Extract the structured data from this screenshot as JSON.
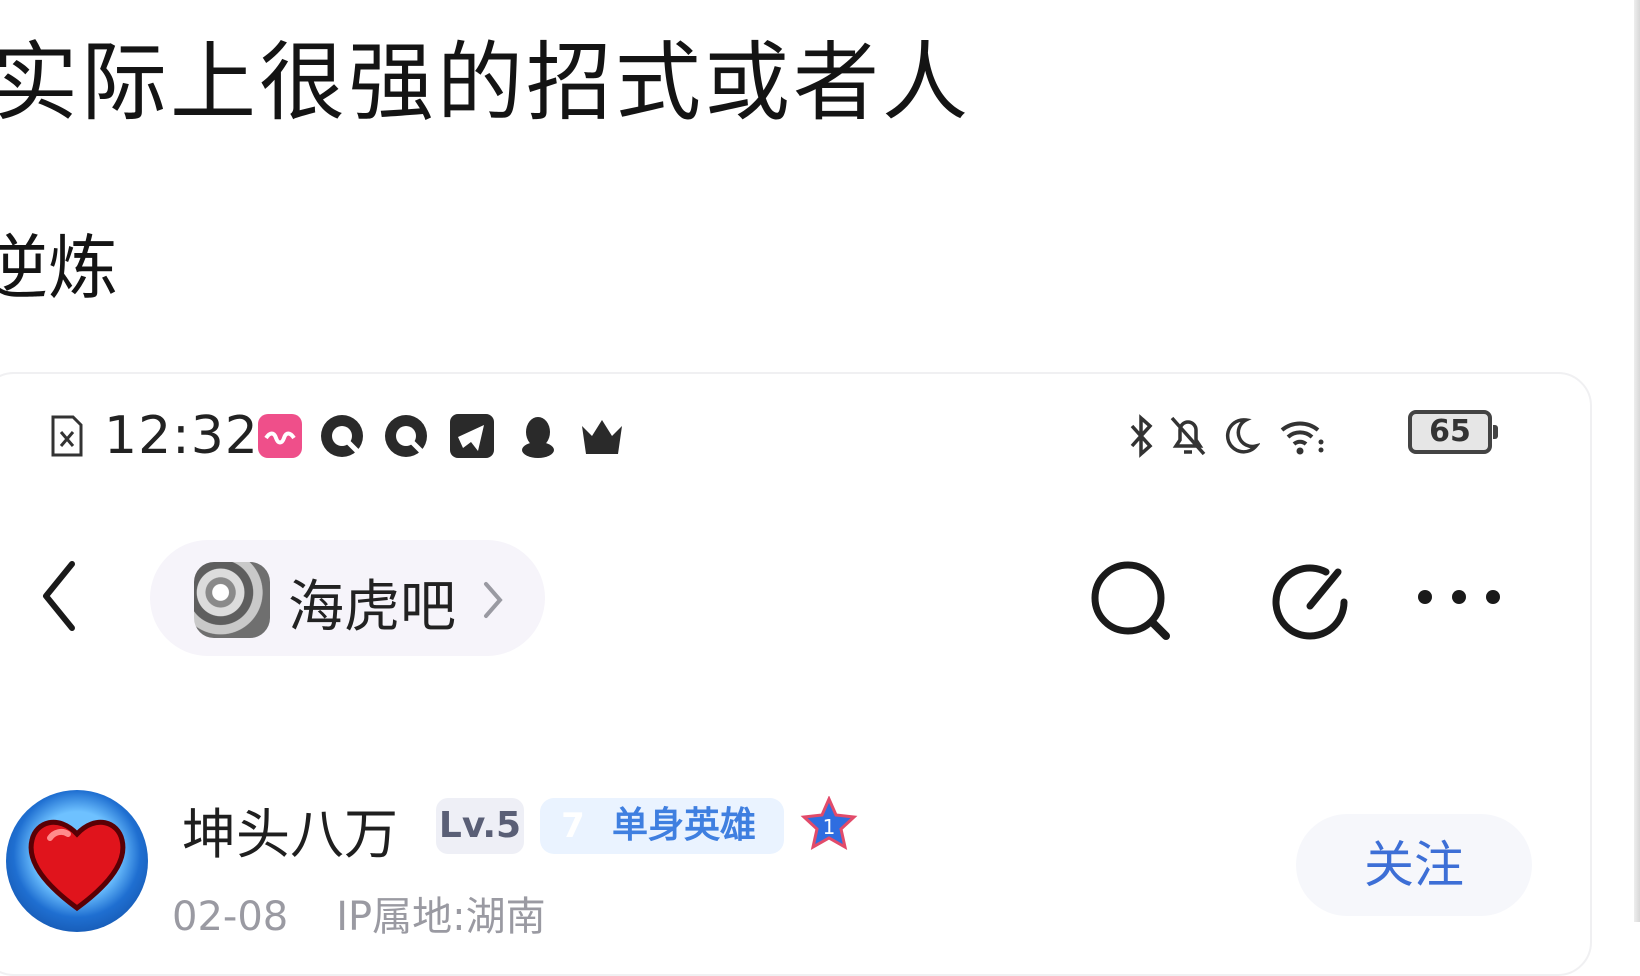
{
  "post": {
    "title": "实际上很强的招式或者人",
    "body": "逆炼"
  },
  "screenshot": {
    "status_bar": {
      "time": "12:32",
      "battery": "65",
      "left_icons": [
        "file-x-icon",
        "app-pink-icon",
        "quark-icon",
        "quark-icon",
        "telegram-icon",
        "qq-icon",
        "crown-icon"
      ],
      "right_icons": [
        "bluetooth-icon",
        "bell-off-icon",
        "moon-icon",
        "wifi-icon",
        "battery-icon"
      ]
    },
    "nav": {
      "forum_name": "海虎吧",
      "icons": [
        "back-icon",
        "search-icon",
        "share-icon",
        "more-icon"
      ]
    },
    "author": {
      "name": "坤头八万",
      "level": "Lv.5",
      "title_rank": "7",
      "title_text": "单身英雄",
      "date": "02-08",
      "ip_location": "IP属地:湖南",
      "follow_label": "关注"
    }
  },
  "colors": {
    "accent_blue": "#3d6fd6",
    "badge_blue": "#4a9bf0",
    "text_dark": "#141414",
    "text_gray": "#9a9aa2"
  }
}
